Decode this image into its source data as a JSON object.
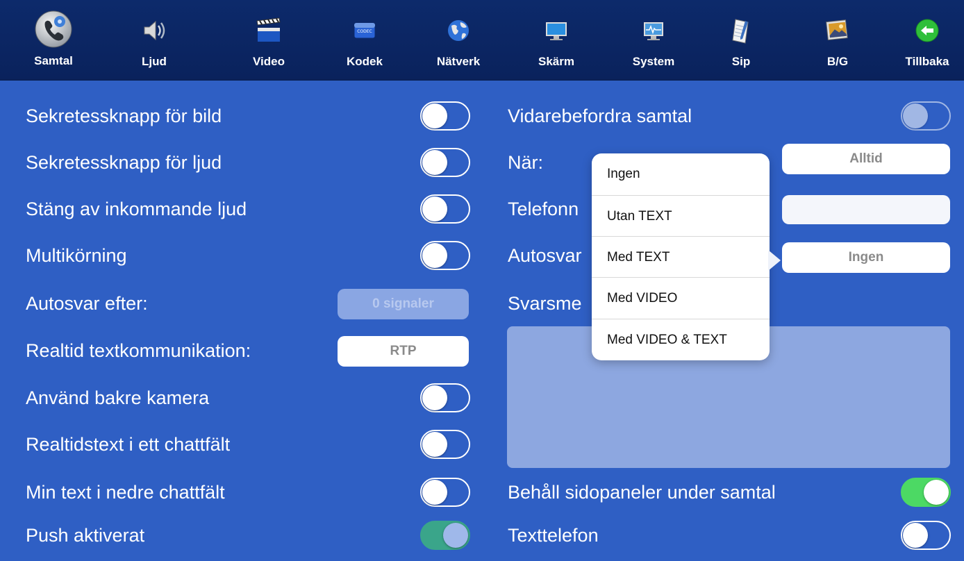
{
  "toolbar": {
    "tabs": [
      {
        "label": "Samtal",
        "icon": "phone-gear-icon"
      },
      {
        "label": "Ljud",
        "icon": "speaker-icon"
      },
      {
        "label": "Video",
        "icon": "clapperboard-icon"
      },
      {
        "label": "Kodek",
        "icon": "codec-icon"
      },
      {
        "label": "Nätverk",
        "icon": "globe-icon"
      },
      {
        "label": "Skärm",
        "icon": "monitor-icon"
      },
      {
        "label": "System",
        "icon": "system-monitor-icon"
      },
      {
        "label": "Sip",
        "icon": "notepad-icon"
      },
      {
        "label": "B/G",
        "icon": "picture-icon"
      },
      {
        "label": "Tillbaka",
        "icon": "back-arrow-icon"
      }
    ],
    "active": "Samtal",
    "icon_codec_text": "CODEC"
  },
  "left": {
    "privacy_video": {
      "label": "Sekretessknapp för bild",
      "on": false
    },
    "privacy_audio": {
      "label": "Sekretessknapp för ljud",
      "on": false
    },
    "mute_incoming": {
      "label": "Stäng av inkommande ljud",
      "on": false
    },
    "multitasking": {
      "label": "Multikörning",
      "on": false
    },
    "autoanswer_after": {
      "label": "Autosvar efter:",
      "value": "0 signaler"
    },
    "realtime_text": {
      "label": "Realtid textkommunikation:",
      "value": "RTP"
    },
    "rear_camera": {
      "label": "Använd bakre kamera",
      "on": false
    },
    "rtt_one_field": {
      "label": "Realtidstext i ett chattfält",
      "on": false
    },
    "my_text_lower": {
      "label": "Min text i nedre chattfält",
      "on": false
    },
    "push": {
      "label": "Push aktiverat",
      "on": true
    }
  },
  "right": {
    "forward_calls": {
      "label": "Vidarebefordra samtal",
      "on": false
    },
    "when": {
      "label": "När:",
      "value": "Alltid"
    },
    "phone": {
      "label": "Telefonn",
      "value": ""
    },
    "autoanswer": {
      "label": "Autosvar",
      "value": "Ingen"
    },
    "answer_message": {
      "label": "Svarsme"
    },
    "keep_side_panels": {
      "label": "Behåll sidopaneler under samtal",
      "on": true
    },
    "text_phone": {
      "label": "Texttelefon",
      "on": false
    }
  },
  "popover": {
    "options": [
      "Ingen",
      "Utan TEXT",
      "Med TEXT",
      "Med VIDEO",
      "Med VIDEO & TEXT"
    ]
  },
  "colors": {
    "background": "#2f5fc4",
    "toolbar": "#0d2a6b",
    "toggle_on": "#4cd964",
    "toggle_push": "#3aa58a"
  }
}
